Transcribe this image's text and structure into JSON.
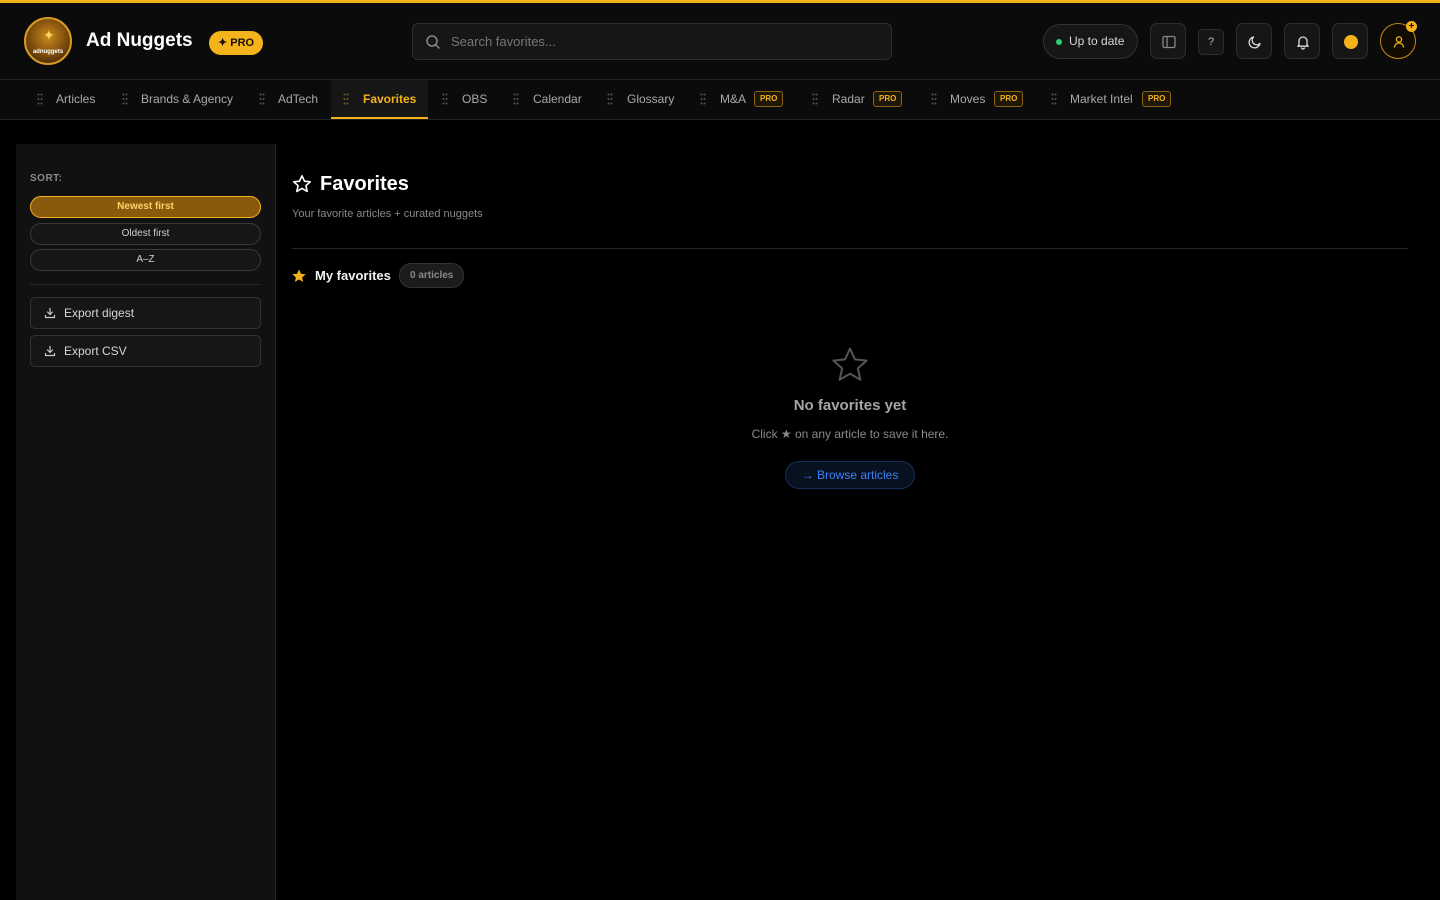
{
  "header": {
    "logo_text": "adnuggets",
    "app_title": "Ad Nuggets",
    "pro_badge": "✦ PRO",
    "search_placeholder": "Search favorites...",
    "status": "Up to date",
    "help_label": "?"
  },
  "tabs": [
    {
      "label": "Articles",
      "pro": ""
    },
    {
      "label": "Brands & Agency",
      "pro": ""
    },
    {
      "label": "AdTech",
      "pro": ""
    },
    {
      "label": "Favorites",
      "pro": "",
      "active": true
    },
    {
      "label": "OBS",
      "pro": ""
    },
    {
      "label": "Calendar",
      "pro": ""
    },
    {
      "label": "Glossary",
      "pro": ""
    },
    {
      "label": "M&A",
      "pro": "PRO"
    },
    {
      "label": "Radar",
      "pro": "PRO"
    },
    {
      "label": "Moves",
      "pro": "PRO"
    },
    {
      "label": "Market Intel",
      "pro": "PRO"
    }
  ],
  "sidebar": {
    "sort_label": "SORT:",
    "sort_options": [
      "Newest first",
      "Oldest first",
      "A–Z"
    ],
    "selected_sort": "Newest first",
    "export_digest": "Export digest",
    "export_csv": "Export CSV"
  },
  "main": {
    "title": "Favorites",
    "subtitle": "Your favorite articles + curated nuggets",
    "section_title": "My favorites",
    "count": "0 articles",
    "empty_title": "No favorites yet",
    "empty_text": "Click ★ on any article to save it here.",
    "browse_label": "→ Browse articles"
  },
  "colors": {
    "accent": "#f5b31b",
    "status_ok": "#2ecc71",
    "link": "#3b82f6"
  }
}
